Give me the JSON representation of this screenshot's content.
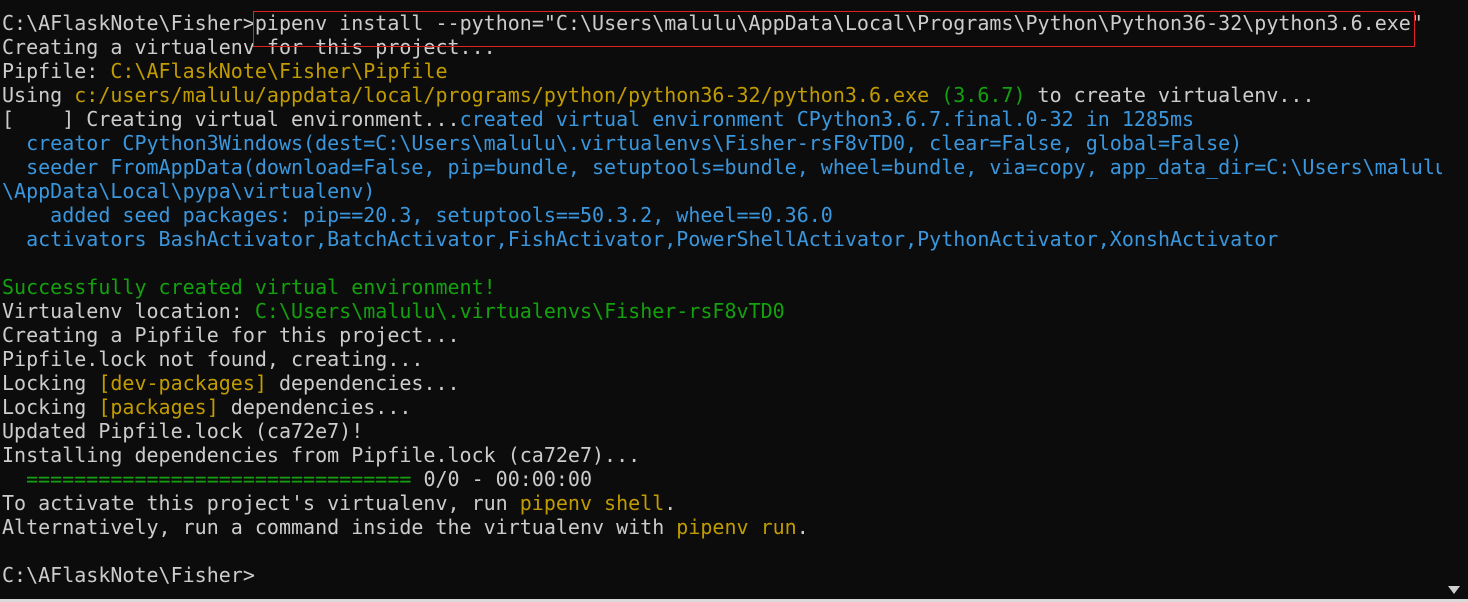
{
  "terminal": {
    "lines": [
      [
        {
          "t": "C:\\AFlaskNote\\Fisher>",
          "c": "default"
        },
        {
          "t": "pipenv install --python=\"C:\\Users\\malulu\\AppData\\Local\\Programs\\Python\\Python36-32\\python3.6.exe\"",
          "c": "default"
        }
      ],
      [
        {
          "t": "Creating a virtualenv for this project...",
          "c": "default"
        }
      ],
      [
        {
          "t": "Pipfile: ",
          "c": "default"
        },
        {
          "t": "C:\\AFlaskNote\\Fisher\\Pipfile",
          "c": "yellow"
        }
      ],
      [
        {
          "t": "Using ",
          "c": "default"
        },
        {
          "t": "c:/users/malulu/appdata/local/programs/python/python36-32/python3.6.exe",
          "c": "yellow"
        },
        {
          "t": " ",
          "c": "default"
        },
        {
          "t": "(3.6.7)",
          "c": "green"
        },
        {
          "t": " to create virtualenv...",
          "c": "default"
        }
      ],
      [
        {
          "t": "[    ] Creating virtual environment...",
          "c": "default"
        },
        {
          "t": "created virtual environment CPython3.6.7.final.0-32 in 1285ms",
          "c": "blue"
        }
      ],
      [
        {
          "t": "  creator CPython3Windows(dest=C:\\Users\\malulu\\.virtualenvs\\Fisher-rsF8vTD0, clear=False, global=False)",
          "c": "blue"
        }
      ],
      [
        {
          "t": "  seeder FromAppData(download=False, pip=bundle, setuptools=bundle, wheel=bundle, via=copy, app_data_dir=C:\\Users\\malulu",
          "c": "blue"
        }
      ],
      [
        {
          "t": "\\AppData\\Local\\pypa\\virtualenv)",
          "c": "blue"
        }
      ],
      [
        {
          "t": "    added seed packages: pip==20.3, setuptools==50.3.2, wheel==0.36.0",
          "c": "blue"
        }
      ],
      [
        {
          "t": "  activators BashActivator,BatchActivator,FishActivator,PowerShellActivator,PythonActivator,XonshActivator",
          "c": "blue"
        }
      ],
      [],
      [
        {
          "t": "Successfully created virtual environment!",
          "c": "green"
        }
      ],
      [
        {
          "t": "Virtualenv location: ",
          "c": "default"
        },
        {
          "t": "C:\\Users\\malulu\\.virtualenvs\\Fisher-rsF8vTD0",
          "c": "green"
        }
      ],
      [
        {
          "t": "Creating a Pipfile for this project...",
          "c": "default"
        }
      ],
      [
        {
          "t": "Pipfile.lock not found, creating...",
          "c": "default"
        }
      ],
      [
        {
          "t": "Locking ",
          "c": "default"
        },
        {
          "t": "[dev-packages]",
          "c": "yellow"
        },
        {
          "t": " dependencies...",
          "c": "default"
        }
      ],
      [
        {
          "t": "Locking ",
          "c": "default"
        },
        {
          "t": "[packages]",
          "c": "yellow"
        },
        {
          "t": " dependencies...",
          "c": "default"
        }
      ],
      [
        {
          "t": "Updated Pipfile.lock (ca72e7)!",
          "c": "default"
        }
      ],
      [
        {
          "t": "Installing dependencies from Pipfile.lock (ca72e7)...",
          "c": "default"
        }
      ],
      [
        {
          "t": "  ================================ ",
          "c": "green"
        },
        {
          "t": "0/0 - 00:00:00",
          "c": "default"
        }
      ],
      [
        {
          "t": "To activate this project's virtualenv, run ",
          "c": "default"
        },
        {
          "t": "pipenv shell",
          "c": "yellow"
        },
        {
          "t": ".",
          "c": "default"
        }
      ],
      [
        {
          "t": "Alternatively, run a command inside the virtualenv with ",
          "c": "default"
        },
        {
          "t": "pipenv run",
          "c": "yellow"
        },
        {
          "t": ".",
          "c": "default"
        }
      ],
      [],
      [
        {
          "t": "C:\\AFlaskNote\\Fisher>",
          "c": "default"
        }
      ]
    ]
  }
}
